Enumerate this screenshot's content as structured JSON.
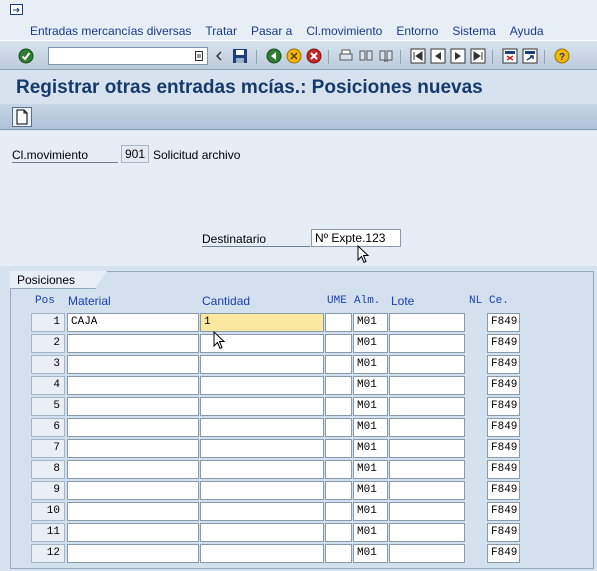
{
  "menu": {
    "items": [
      "Entradas mercancías diversas",
      "Tratar",
      "Pasar a",
      "Cl.movimiento",
      "Entorno",
      "Sistema",
      "Ayuda"
    ]
  },
  "toolbar": {
    "command_value": "",
    "icons": [
      "enter-icon",
      "save-icon",
      "back-icon",
      "exit-icon",
      "cancel-icon",
      "print-icon",
      "find-icon",
      "find-next-icon",
      "first-page-icon",
      "previous-page-icon",
      "next-page-icon",
      "last-page-icon",
      "new-session-icon",
      "shortcut-icon",
      "help-icon"
    ]
  },
  "title": "Registrar otras entradas mcías.: Posiciones nuevas",
  "header": {
    "movement_type_label": "Cl.movimiento",
    "movement_type_value": "901",
    "movement_type_desc": "Solicitud archivo",
    "recipient_label": "Destinatario",
    "recipient_value": "Nº Expte.123"
  },
  "positions": {
    "group_label": "Posiciones",
    "columns": {
      "pos": "Pos",
      "material": "Material",
      "quantity": "Cantidad",
      "uom": "UME",
      "storage": "Alm.",
      "batch": "Lote",
      "nl": "NL",
      "plant": "Ce."
    },
    "rows": [
      {
        "pos": "1",
        "material": "CAJA",
        "quantity": "1",
        "storage": "M01",
        "plant": "F849"
      },
      {
        "pos": "2",
        "material": "",
        "quantity": "",
        "storage": "M01",
        "plant": "F849"
      },
      {
        "pos": "3",
        "material": "",
        "quantity": "",
        "storage": "M01",
        "plant": "F849"
      },
      {
        "pos": "4",
        "material": "",
        "quantity": "",
        "storage": "M01",
        "plant": "F849"
      },
      {
        "pos": "5",
        "material": "",
        "quantity": "",
        "storage": "M01",
        "plant": "F849"
      },
      {
        "pos": "6",
        "material": "",
        "quantity": "",
        "storage": "M01",
        "plant": "F849"
      },
      {
        "pos": "7",
        "material": "",
        "quantity": "",
        "storage": "M01",
        "plant": "F849"
      },
      {
        "pos": "8",
        "material": "",
        "quantity": "",
        "storage": "M01",
        "plant": "F849"
      },
      {
        "pos": "9",
        "material": "",
        "quantity": "",
        "storage": "M01",
        "plant": "F849"
      },
      {
        "pos": "10",
        "material": "",
        "quantity": "",
        "storage": "M01",
        "plant": "F849"
      },
      {
        "pos": "11",
        "material": "",
        "quantity": "",
        "storage": "M01",
        "plant": "F849"
      },
      {
        "pos": "12",
        "material": "",
        "quantity": "",
        "storage": "M01",
        "plant": "F849"
      }
    ]
  }
}
